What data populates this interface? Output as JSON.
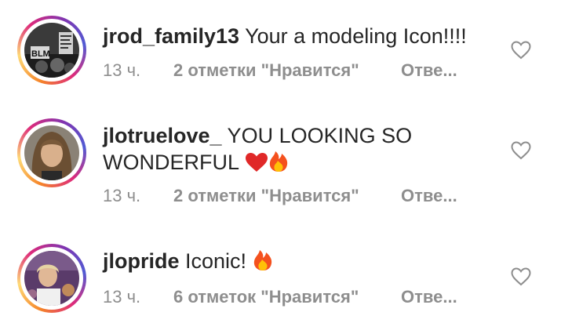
{
  "comments": [
    {
      "username": "jrod_family13",
      "text": " Your a modeling Icon!!!!",
      "time": "13 ч.",
      "likes": "2 отметки \"Нравится\"",
      "reply": "Отве..."
    },
    {
      "username": "jlotruelove_",
      "text": " YOU LOOKING SO WONDERFUL ",
      "time": "13 ч.",
      "likes": "2 отметки \"Нравится\"",
      "reply": "Отве..."
    },
    {
      "username": "jlopride",
      "text": " Iconic! ",
      "time": "13 ч.",
      "likes": "6 отметок \"Нравится\"",
      "reply": "Отве..."
    }
  ],
  "avatar_0_text": "BLM",
  "colors": {
    "text": "#262626",
    "meta": "#8e8e8e",
    "heart": "#8e8e8e"
  }
}
